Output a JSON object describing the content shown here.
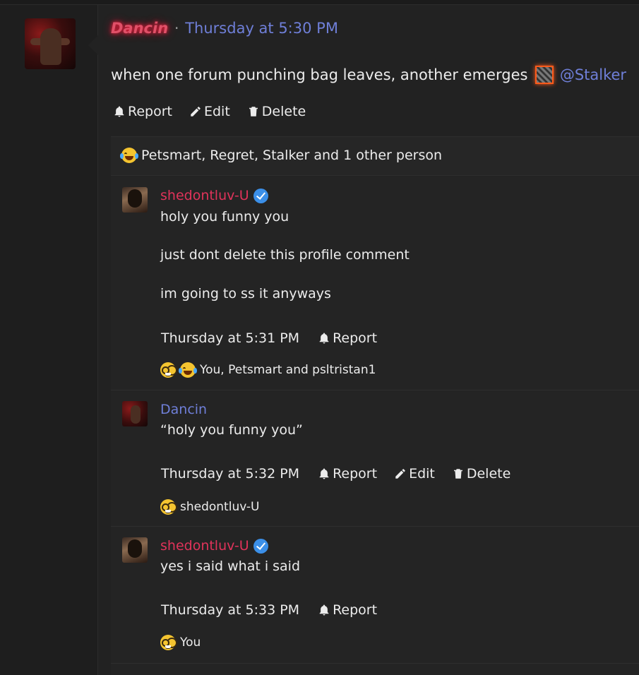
{
  "post": {
    "author": "Dancin",
    "separator": "·",
    "timestamp": "Thursday at 5:30 PM",
    "body_text": "when one forum punching bag leaves, another emerges",
    "mention": "@Stalker",
    "actions": {
      "report": "Report",
      "edit": "Edit",
      "delete": "Delete"
    },
    "reactions_summary": "Petsmart, Regret, Stalker and 1 other person"
  },
  "comments": [
    {
      "author": "shedontluv-U",
      "verified": true,
      "lines": [
        "holy you funny you",
        "just dont delete this profile comment",
        "im going to ss it anyways"
      ],
      "timestamp": "Thursday at 5:31 PM",
      "actions": {
        "report": "Report"
      },
      "reactions": "You, Petsmart and psltristan1"
    },
    {
      "author": "Dancin",
      "verified": false,
      "lines": [
        "“holy you funny you”"
      ],
      "timestamp": "Thursday at 5:32 PM",
      "actions": {
        "report": "Report",
        "edit": "Edit",
        "delete": "Delete"
      },
      "reactions": "shedontluv-U"
    },
    {
      "author": "shedontluv-U",
      "verified": true,
      "lines": [
        "yes i said what i said"
      ],
      "timestamp": "Thursday at 5:33 PM",
      "actions": {
        "report": "Report"
      },
      "reactions": "You"
    }
  ],
  "colors": {
    "author_primary": "#e05068",
    "link_blue": "#6f7fd8",
    "username_red": "#e0335a",
    "verified_blue": "#3b8fe8",
    "mention_highlight": "#ff5a1a"
  },
  "icons": {
    "report": "bell-icon",
    "edit": "pencil-icon",
    "delete": "trash-icon",
    "verified": "verified-check-icon",
    "laugh": "tears-of-joy-emoji",
    "nerd": "nerd-face-emoji"
  }
}
